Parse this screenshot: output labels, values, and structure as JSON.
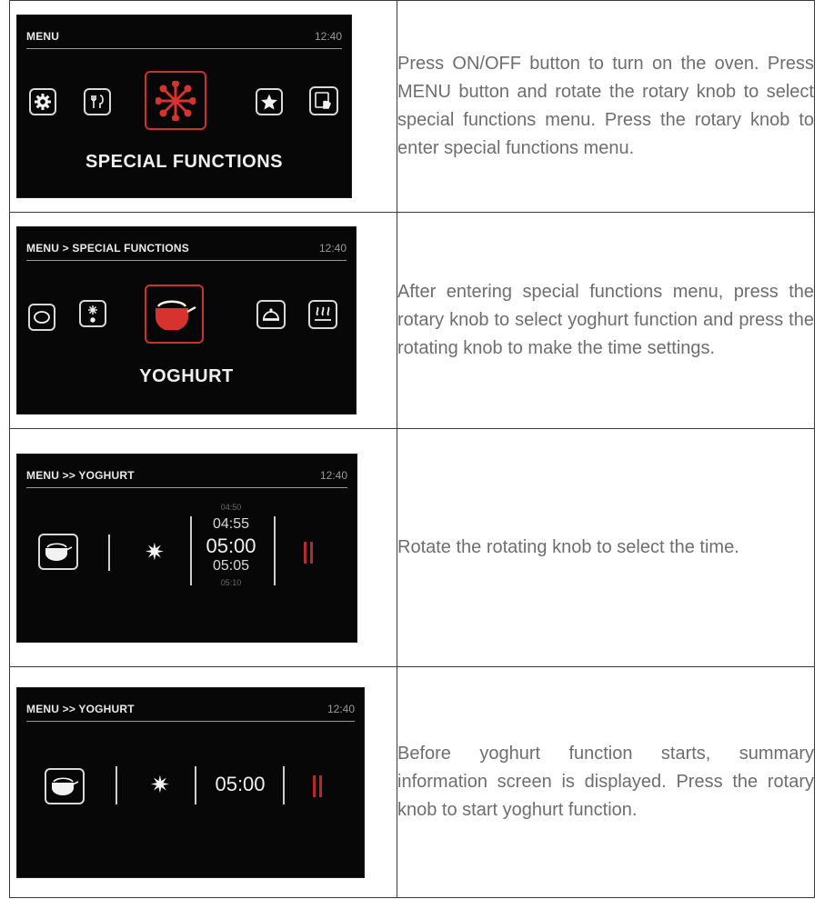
{
  "rows": [
    {
      "screen": {
        "breadcrumb": "MENU",
        "clock": "12:40",
        "icons": [
          "settings-gear-icon",
          "cutlery-icon",
          "snowflake-icon",
          "star-icon",
          "recipe-hand-icon"
        ],
        "selected_icon": "snowflake-icon",
        "title": "SPECIAL FUNCTIONS"
      },
      "text": "Press ON/OFF button to turn on the oven. Press MENU button and rotate the rotary knob to select special functions menu. Press the rotary knob to enter special functions menu."
    },
    {
      "screen": {
        "breadcrumb": "MENU > SPECIAL FUNCTIONS",
        "clock": "12:40",
        "icons": [
          "dough-icon",
          "defrost-icon",
          "yoghurt-pan-icon",
          "dome-icon",
          "steam-icon"
        ],
        "selected_icon": "yoghurt-pan-icon",
        "title": "YOGHURT"
      },
      "text": "After entering special functions menu, press the rotary knob to select yoghurt function and press the rotating knob to make the time settings."
    },
    {
      "screen": {
        "breadcrumb": "MENU >> YOGHURT",
        "clock": "12:40",
        "time_options": [
          "04:50",
          "04:55",
          "05:00",
          "05:05",
          "05:10"
        ],
        "selected_time": "05:00"
      },
      "text": "Rotate the rotating knob to select the time."
    },
    {
      "screen": {
        "breadcrumb": "MENU >> YOGHURT",
        "clock": "12:40",
        "time": "05:00"
      },
      "text": "Before yoghurt function starts, summary information screen is displayed. Press the rotary knob to start yoghurt function."
    }
  ],
  "colors": {
    "accent_red": "#c8322f",
    "screen_bg": "#070707",
    "text_gray": "#6e6e6e"
  }
}
